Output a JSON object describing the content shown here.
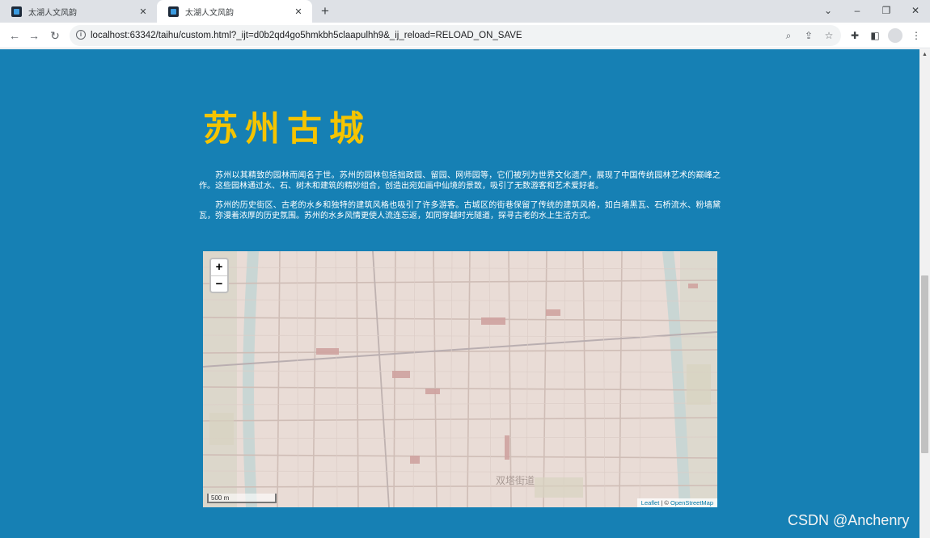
{
  "browser": {
    "tabs": [
      {
        "title": "太湖人文风韵",
        "active": false
      },
      {
        "title": "太湖人文风韵",
        "active": true
      }
    ],
    "new_tab_icon": "plus-icon",
    "url": "localhost:63342/taihu/custom.html?_ijt=d0b2qd4go5hmkbh5claapulhh9&_ij_reload=RELOAD_ON_SAVE"
  },
  "page": {
    "title": "苏州古城",
    "paragraphs": [
      "苏州以其精致的园林而闻名于世。苏州的园林包括拙政园、留园、网师园等，它们被列为世界文化遗产，展现了中国传统园林艺术的巅峰之作。这些园林通过水、石、树木和建筑的精妙组合，创造出宛如画中仙境的景致，吸引了无数游客和艺术爱好者。",
      "苏州的历史街区、古老的水乡和独特的建筑风格也吸引了许多游客。古城区的街巷保留了传统的建筑风格，如白墙黑瓦、石桥流水、粉墙黛瓦，弥漫着浓厚的历史氛围。苏州的水乡风情更使人流连忘返，如同穿越时光隧道，探寻古老的水上生活方式。"
    ],
    "background_color": "#1680b4",
    "title_color": "#f5c400"
  },
  "map": {
    "zoom_in": "+",
    "zoom_out": "−",
    "scale_label": "500 m",
    "attribution_leaflet": "Leaflet",
    "attribution_sep": " | © ",
    "attribution_osm": "OpenStreetMap",
    "place_label": "双塔街道"
  },
  "watermark": "CSDN @Anchenry"
}
